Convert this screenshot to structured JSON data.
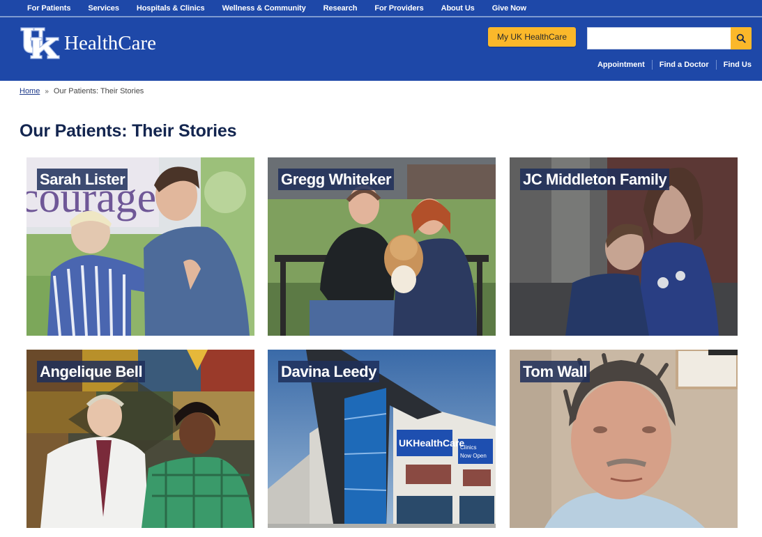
{
  "topnav": {
    "items": [
      {
        "label": "For Patients"
      },
      {
        "label": "Services"
      },
      {
        "label": "Hospitals & Clinics"
      },
      {
        "label": "Wellness & Community"
      },
      {
        "label": "Research"
      },
      {
        "label": "For Providers"
      },
      {
        "label": "About Us"
      },
      {
        "label": "Give Now"
      }
    ]
  },
  "header": {
    "logo_mark": "UK",
    "logo_text": "HealthCare",
    "my_uk_button": "My UK HealthCare",
    "search": {
      "value": "",
      "placeholder": "",
      "button_icon": "search-icon"
    },
    "quicklinks": [
      {
        "label": "Appointment"
      },
      {
        "label": "Find a Doctor"
      },
      {
        "label": "Find Us"
      }
    ]
  },
  "breadcrumb": {
    "home": "Home",
    "separator": "»",
    "current": "Our Patients: Their Stories"
  },
  "page": {
    "title": "Our Patients: Their Stories"
  },
  "stories": [
    {
      "name": "Sarah Lister",
      "image": "woman-and-young-man-outdoors-photo"
    },
    {
      "name": "Gregg Whiteker",
      "image": "couple-with-dog-on-bench-photo"
    },
    {
      "name": "JC Middleton Family",
      "image": "two-children-hugging-photo"
    },
    {
      "name": "Angelique Bell",
      "image": "doctor-and-patient-quilt-photo"
    },
    {
      "name": "Davina Leedy",
      "image": "uk-healthcare-clinic-building-photo",
      "sign_text": "UKHealthCare",
      "sign_text_2": "Clinics Now Open"
    },
    {
      "name": "Tom Wall",
      "image": "man-portrait-photo"
    }
  ],
  "colors": {
    "brand_blue": "#1e48a8",
    "accent_gold": "#fbb82a",
    "title_navy": "#13254f",
    "label_bg": "#1e2f5a"
  }
}
